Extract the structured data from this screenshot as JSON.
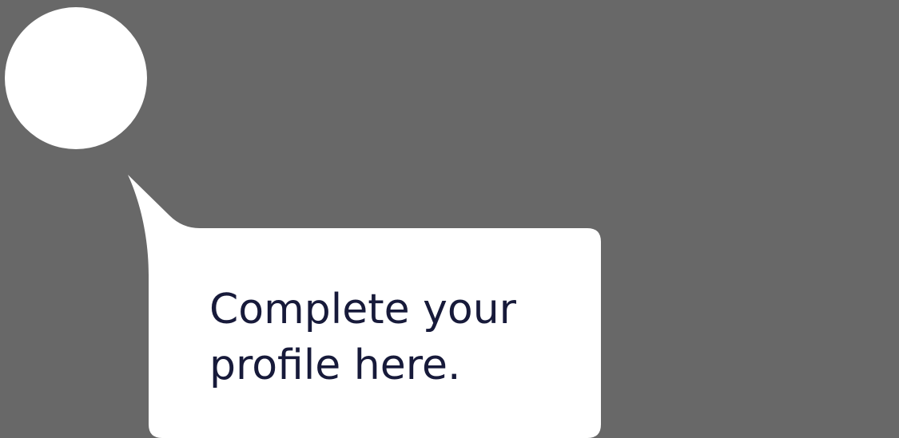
{
  "coachmark": {
    "message_line_1": "Complete your",
    "message_line_2": "profile here."
  },
  "colors": {
    "overlay": "#686868",
    "bubble": "#ffffff",
    "text": "#171a3a"
  }
}
